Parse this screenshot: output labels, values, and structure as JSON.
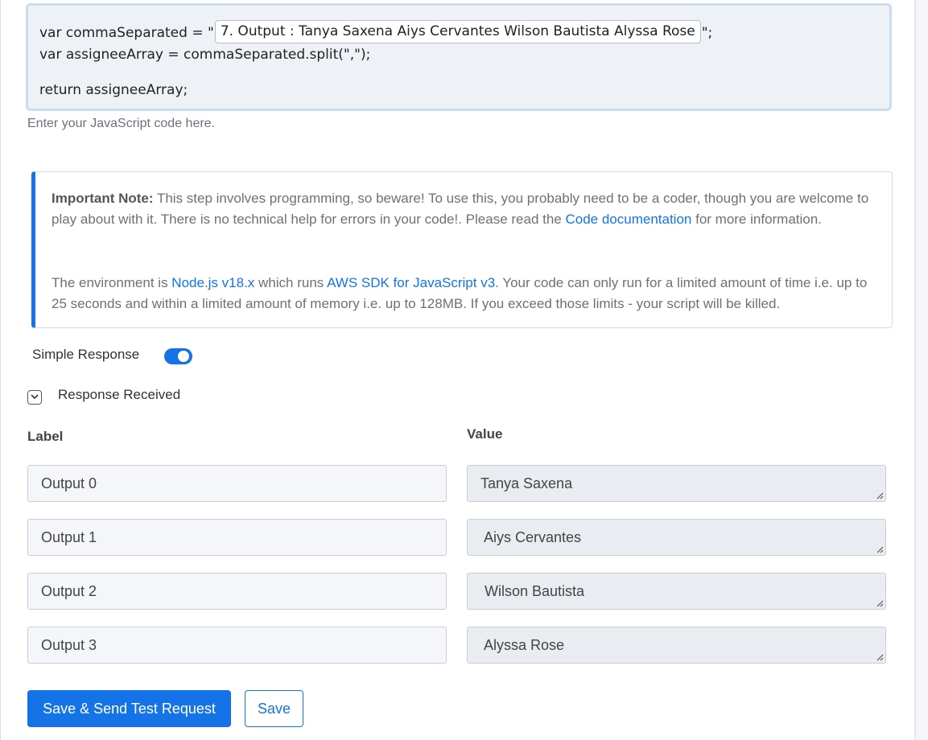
{
  "code": {
    "line1_prefix": "var commaSeparated = \"",
    "line1_token": "7. Output : Tanya Saxena Aiys Cervantes Wilson Bautista Alyssa Rose",
    "line1_suffix": "\";",
    "line2": "var assigneeArray = commaSeparated.split(\",\");",
    "line3": "return assigneeArray;",
    "help": "Enter your JavaScript code here."
  },
  "note": {
    "bold": "Important Note:",
    "text1": " This step involves programming, so beware! To use this, you probably need to be a coder, though you are welcome to play about with it. There is no technical help for errors in your code!. Please read the ",
    "link_docs": "Code documentation",
    "text2": " for more information.",
    "env_text1": "The environment is ",
    "link_node": "Node.js v18.x",
    "env_text2": " which runs ",
    "link_aws": "AWS SDK for JavaScript v3",
    "env_text3": ". Your code can only run for a limited amount of time i.e. up to 25 seconds and within a limited amount of memory i.e. up to 128MB. If you exceed those limits - your script will be killed."
  },
  "simple_response": {
    "label": "Simple Response",
    "enabled": true
  },
  "response_received": {
    "label": "Response Received"
  },
  "columns": {
    "label": "Label",
    "value": "Value"
  },
  "rows": [
    {
      "label": "Output 0",
      "value": "Tanya Saxena"
    },
    {
      "label": "Output 1",
      "value": " Aiys Cervantes"
    },
    {
      "label": "Output 2",
      "value": " Wilson Bautista"
    },
    {
      "label": "Output 3",
      "value": " Alyssa Rose"
    }
  ],
  "buttons": {
    "send": "Save & Send Test Request",
    "save": "Save"
  },
  "colors": {
    "accent": "#1473e6",
    "editor_bg": "#eef2f7",
    "editor_border": "#c9dcf3"
  }
}
